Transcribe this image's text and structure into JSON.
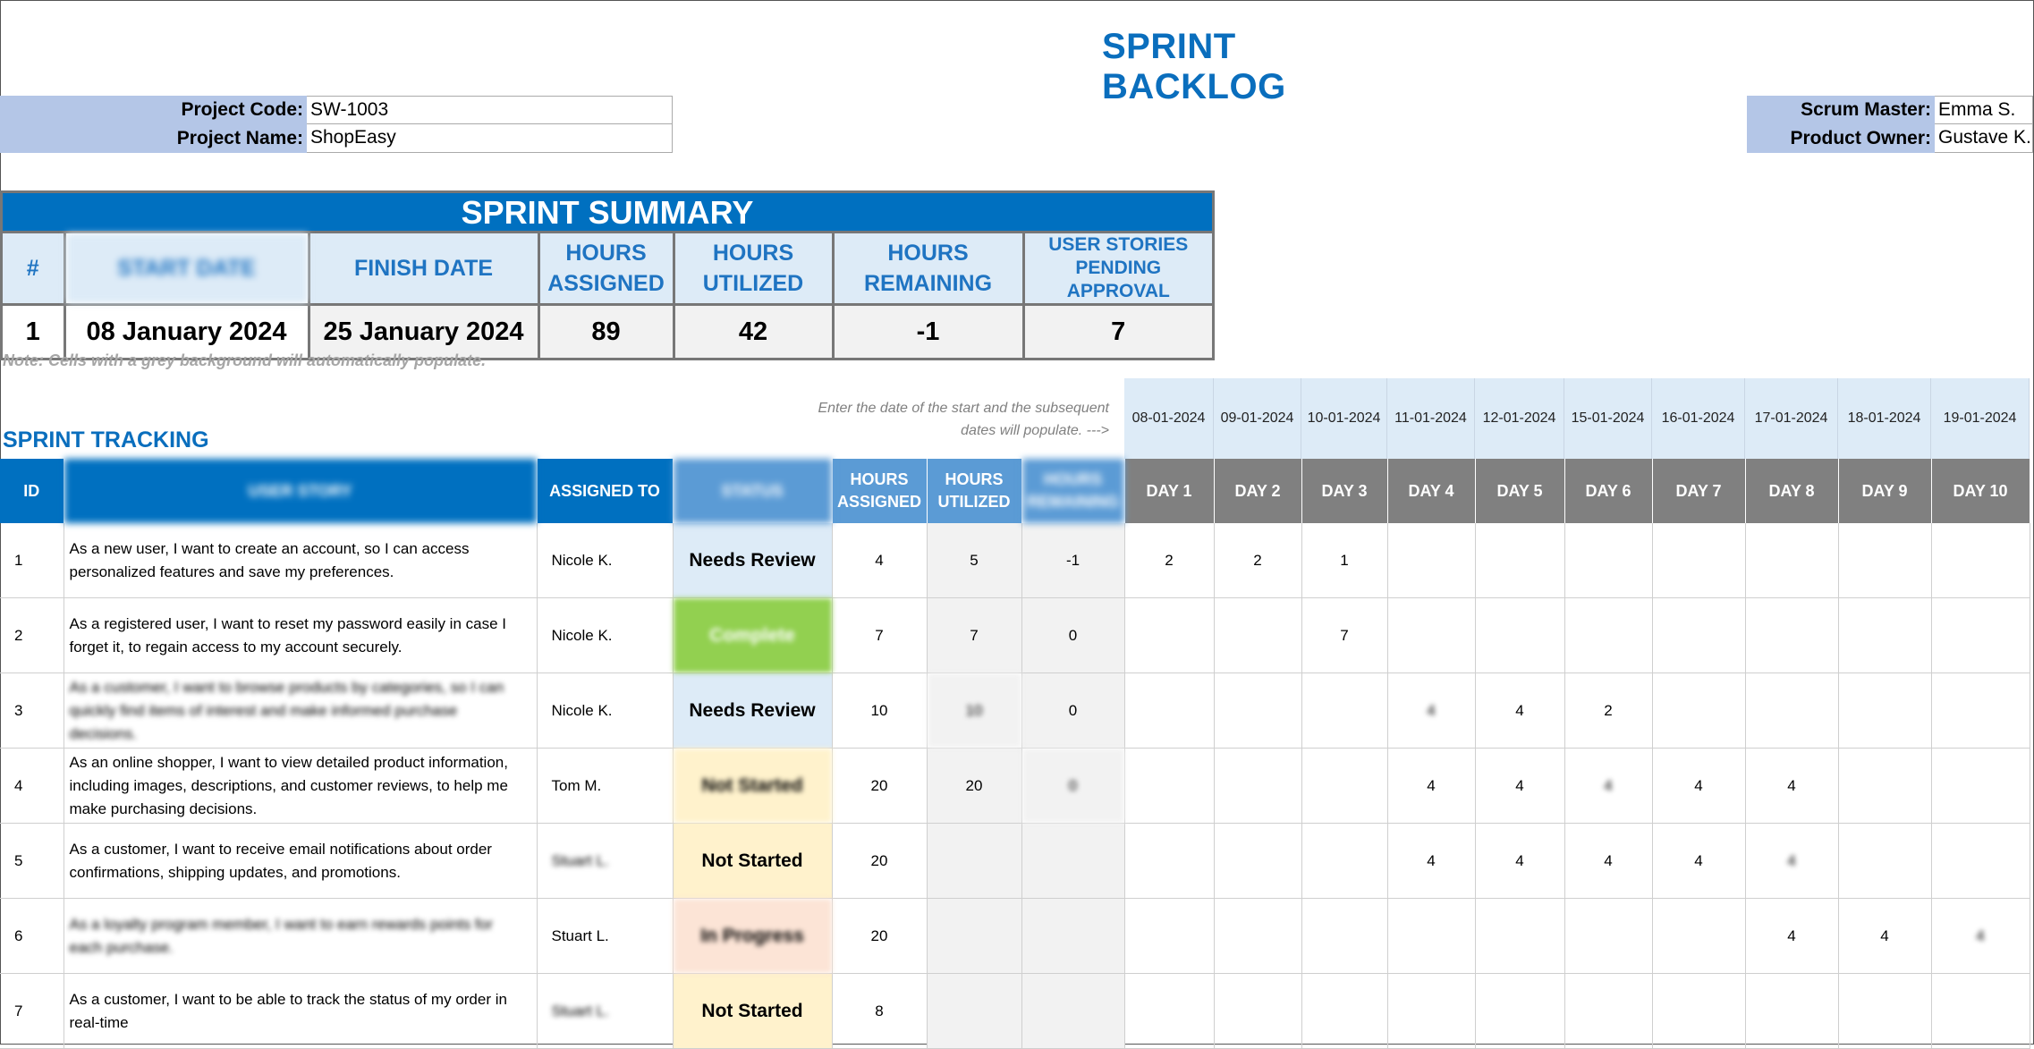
{
  "title": "SPRINT BACKLOG",
  "project": {
    "code_label": "Project Code:",
    "code": "SW-1003",
    "name_label": "Project Name:",
    "name": "ShopEasy"
  },
  "team": {
    "scrum_label": "Scrum Master:",
    "scrum": "Emma S.",
    "owner_label": "Product Owner:",
    "owner": "Gustave K."
  },
  "summary": {
    "band": "SPRINT SUMMARY",
    "headers": [
      "#",
      "START DATE",
      "FINISH DATE",
      "HOURS ASSIGNED",
      "HOURS UTILIZED",
      "HOURS REMAINING",
      "USER STORIES PENDING APPROVAL"
    ],
    "values": [
      "1",
      "08 January 2024",
      "25 January 2024",
      "89",
      "42",
      "-1",
      "7"
    ]
  },
  "note": "Note: Cells with a grey background will automatically populate.",
  "hint": "Enter the date of the start and the subsequent dates will populate.  --->",
  "section_title": "SPRINT TRACKING",
  "dates": [
    "08-01-2024",
    "09-01-2024",
    "10-01-2024",
    "11-01-2024",
    "12-01-2024",
    "15-01-2024",
    "16-01-2024",
    "17-01-2024",
    "18-01-2024",
    "19-01-2024"
  ],
  "columns": [
    "ID",
    "USER STORY",
    "ASSIGNED TO",
    "STATUS",
    "HOURS ASSIGNED",
    "HOURS UTILIZED",
    "HOURS REMAINING",
    "DAY 1",
    "DAY 2",
    "DAY 3",
    "DAY 4",
    "DAY 5",
    "DAY 6",
    "DAY 7",
    "DAY 8",
    "DAY 9",
    "DAY 10"
  ],
  "rows": [
    {
      "id": "1",
      "story": "As a new user, I want to create an account, so I can access personalized features and save my preferences.",
      "assigned": "Nicole K.",
      "status": "Needs Review",
      "assigned_hours": "4",
      "utilized": "5",
      "remaining": "-1",
      "days": [
        "2",
        "2",
        "1",
        "",
        "",
        "",
        "",
        "",
        "",
        ""
      ]
    },
    {
      "id": "2",
      "story": "As a registered user, I want to reset my password easily in case I forget it, to regain access to my account securely.",
      "assigned": "Nicole K.",
      "status": "Complete",
      "assigned_hours": "7",
      "utilized": "7",
      "remaining": "0",
      "days": [
        "",
        "",
        "7",
        "",
        "",
        "",
        "",
        "",
        "",
        ""
      ]
    },
    {
      "id": "3",
      "story": "As a customer, I want to browse products by categories, so I can quickly find items of interest and make informed purchase decisions.",
      "assigned": "Nicole K.",
      "status": "Needs Review",
      "assigned_hours": "10",
      "utilized": "10",
      "remaining": "0",
      "days": [
        "",
        "",
        "",
        "4",
        "4",
        "2",
        "",
        "",
        "",
        ""
      ]
    },
    {
      "id": "4",
      "story": "As an online shopper, I want to view detailed product information, including images, descriptions, and customer reviews, to help me make purchasing decisions.",
      "assigned": "Tom M.",
      "status": "Not Started",
      "assigned_hours": "20",
      "utilized": "20",
      "remaining": "0",
      "days": [
        "",
        "",
        "",
        "4",
        "4",
        "4",
        "4",
        "4",
        "",
        ""
      ]
    },
    {
      "id": "5",
      "story": "As a customer, I want to receive email notifications about order confirmations, shipping updates, and promotions.",
      "assigned": "Stuart L.",
      "status": "Not Started",
      "assigned_hours": "20",
      "utilized": "",
      "remaining": "",
      "days": [
        "",
        "",
        "",
        "4",
        "4",
        "4",
        "4",
        "4",
        "",
        ""
      ]
    },
    {
      "id": "6",
      "story": "As a loyalty program member, I want to earn rewards points for each purchase.",
      "assigned": "Stuart L.",
      "status": "In Progress",
      "assigned_hours": "20",
      "utilized": "",
      "remaining": "",
      "days": [
        "",
        "",
        "",
        "",
        "",
        "",
        "",
        "4",
        "4",
        "4"
      ]
    },
    {
      "id": "7",
      "story": "As a customer, I want to be able to track the status of my order in real-time",
      "assigned": "Stuart L.",
      "status": "Not Started",
      "assigned_hours": "8",
      "utilized": "",
      "remaining": "",
      "days": [
        "",
        "",
        "",
        "",
        "",
        "",
        "",
        "",
        "",
        ""
      ]
    }
  ],
  "colors": {
    "accent": "#0070c0",
    "header_blue": "#5b9bd5",
    "day_header": "#808080",
    "complete": "#92d050",
    "needs_review": "#ddebf7",
    "not_started": "#fff2cc",
    "in_progress": "#fce4d6"
  }
}
